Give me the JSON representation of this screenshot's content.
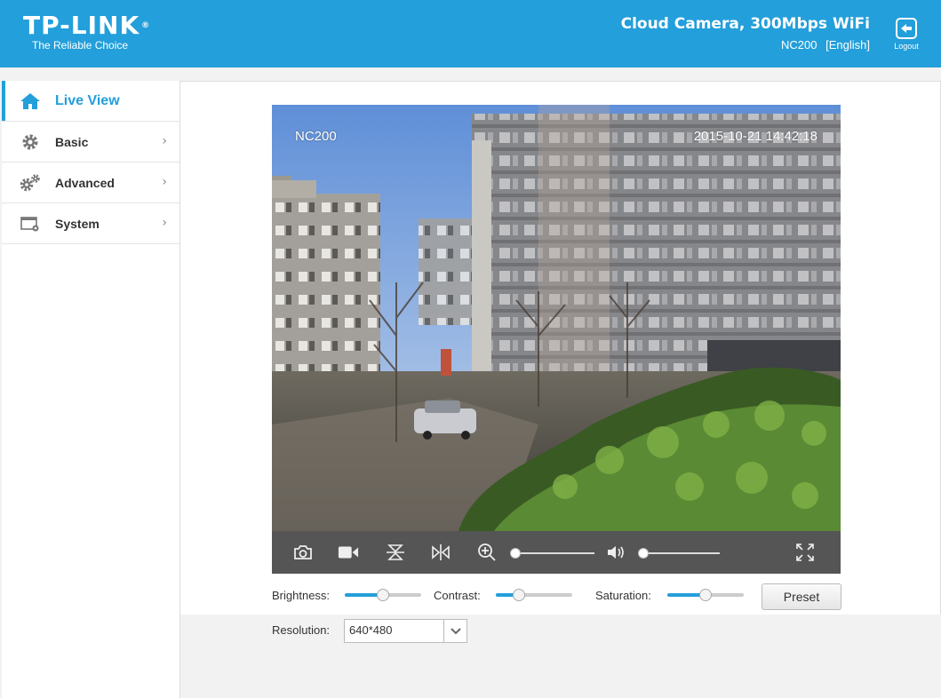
{
  "header": {
    "brand": "TP-LINK",
    "tm": "®",
    "tagline": "The Reliable Choice",
    "product_title": "Cloud Camera, 300Mbps WiFi",
    "model": "NC200",
    "language": "[English]",
    "logout_label": "Logout",
    "bg_color": "#239fdb"
  },
  "sidebar": {
    "items": [
      {
        "label": "Live View",
        "icon": "home-icon",
        "active": true
      },
      {
        "label": "Basic",
        "icon": "gear-icon",
        "active": false
      },
      {
        "label": "Advanced",
        "icon": "gears-icon",
        "active": false
      },
      {
        "label": "System",
        "icon": "window-gear-icon",
        "active": false
      }
    ]
  },
  "video": {
    "camera_name": "NC200",
    "timestamp": "2015-10-21 14:42:18"
  },
  "controls": {
    "icons": [
      "camera-icon",
      "video-record-icon",
      "flip-vertical-icon",
      "mirror-icon",
      "zoom-in-icon",
      "volume-icon",
      "fullscreen-icon"
    ],
    "zoom_level": 0,
    "volume_level": 0
  },
  "image_settings": {
    "brightness_label": "Brightness:",
    "brightness_value": 0.5,
    "contrast_label": "Contrast:",
    "contrast_value": 0.3,
    "saturation_label": "Saturation:",
    "saturation_value": 0.5,
    "preset_label": "Preset"
  },
  "resolution": {
    "label": "Resolution:",
    "value": "640*480"
  },
  "colors": {
    "accent": "#239fdb",
    "control_bar": "#555555"
  }
}
